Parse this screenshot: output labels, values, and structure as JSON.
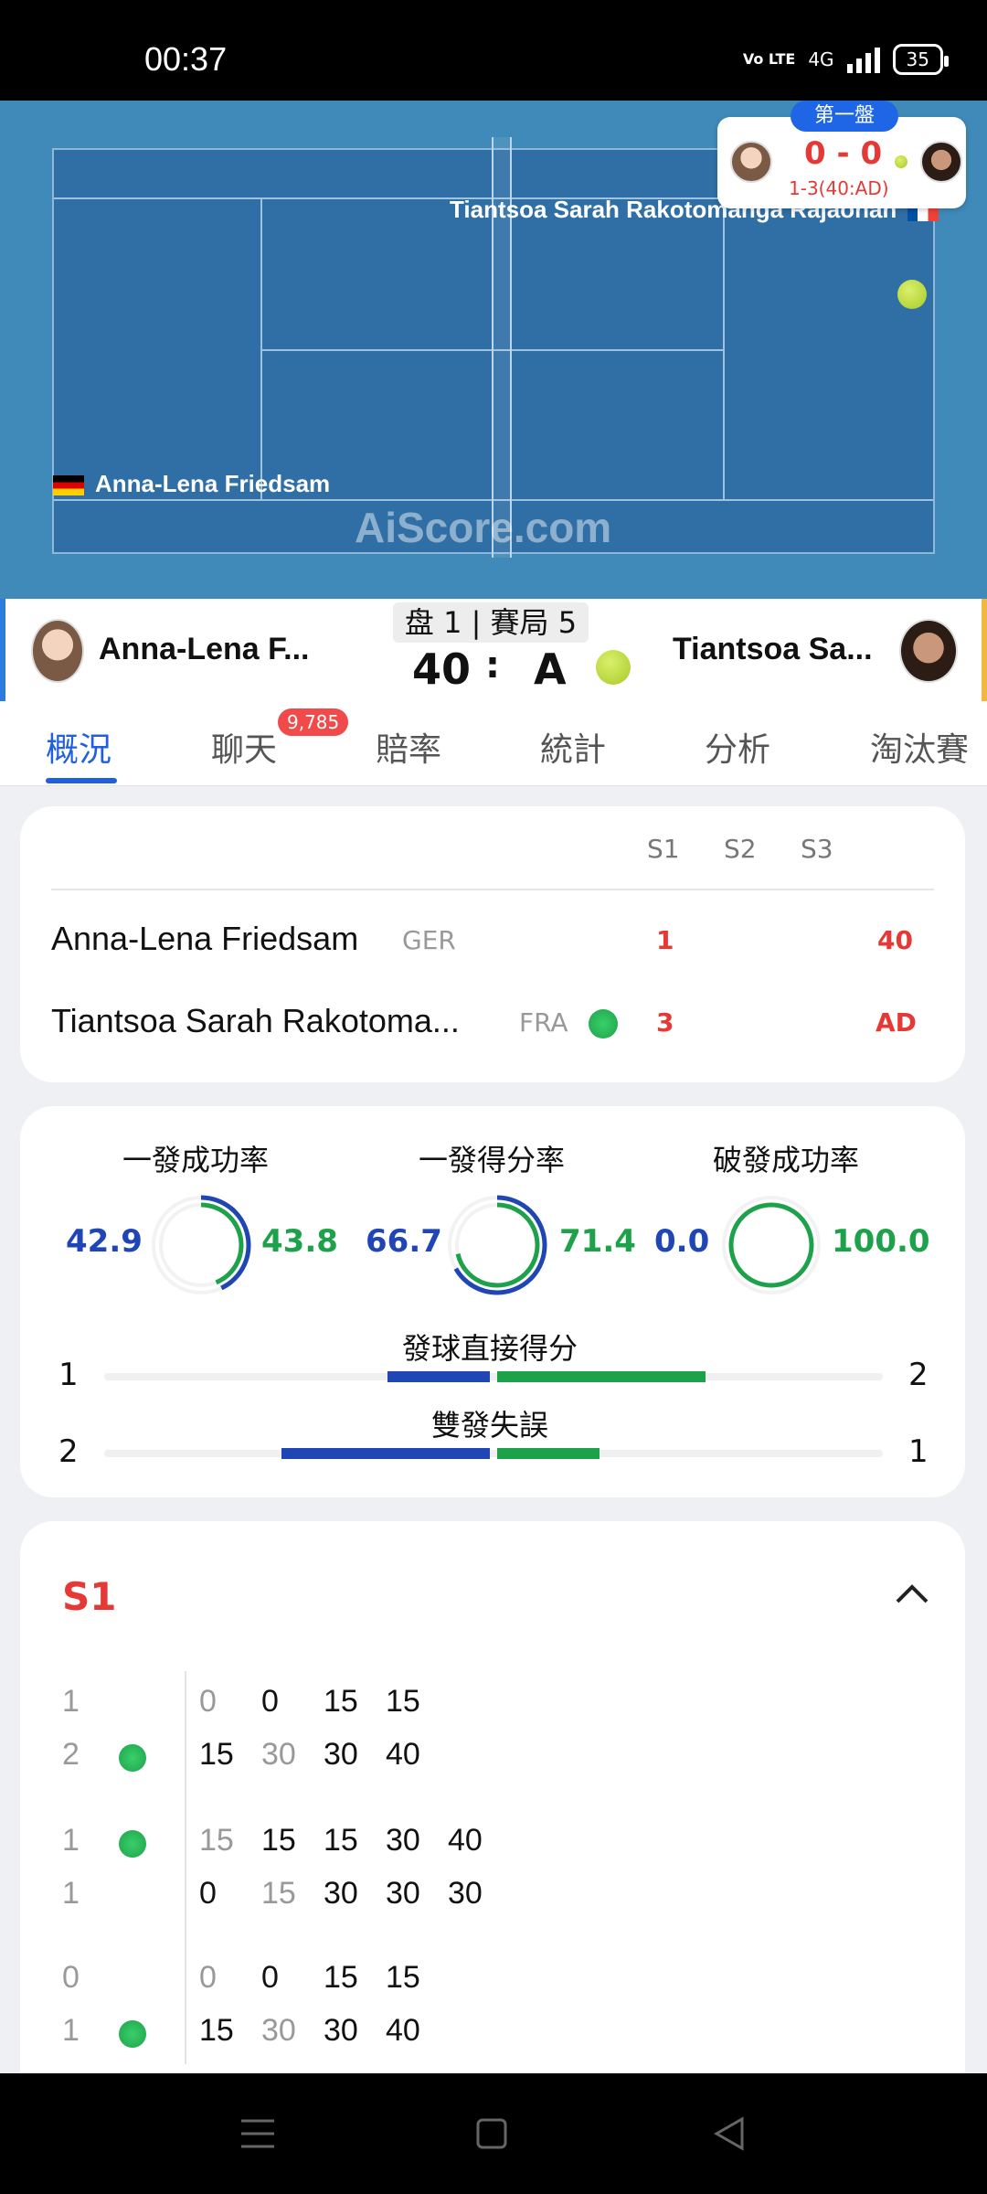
{
  "status_bar": {
    "time": "00:37",
    "network": "4G",
    "lte": "Vo LTE",
    "battery": "35"
  },
  "court": {
    "watermark": "AiScore.com",
    "player_top_label": "Tiantsoa Sarah Rakotomanga Rajaonah",
    "player_bottom_label": "Anna-Lena Friedsam"
  },
  "mini_score": {
    "set_tag": "第一盤",
    "score": "0 - 0",
    "sub": "1-3(40:AD)"
  },
  "match_header": {
    "player1_short": "Anna-Lena F...",
    "player2_short": "Tiantsoa Sa...",
    "set_game": "盘 1 | 賽局 5",
    "p1_points": "40",
    "separator": ":",
    "p2_points": "A"
  },
  "tabs": [
    {
      "label": "概況"
    },
    {
      "label": "聊天",
      "badge": "9,785"
    },
    {
      "label": "賠率"
    },
    {
      "label": "統計"
    },
    {
      "label": "分析"
    },
    {
      "label": "淘汰賽"
    }
  ],
  "scoreboard": {
    "headers": [
      "S1",
      "S2",
      "S3"
    ],
    "rows": [
      {
        "name": "Anna-Lena Friedsam",
        "nat": "GER",
        "s1": "1",
        "current": "40"
      },
      {
        "name": "Tiantsoa Sarah Rakotoma...",
        "nat": "FRA",
        "s1": "3",
        "current": "AD"
      }
    ]
  },
  "stats": {
    "circles": [
      {
        "title": "一發成功率",
        "left": "42.9",
        "right": "43.8",
        "left_frac": 0.429,
        "right_frac": 0.438
      },
      {
        "title": "一發得分率",
        "left": "66.7",
        "right": "71.4",
        "left_frac": 0.667,
        "right_frac": 0.714
      },
      {
        "title": "破發成功率",
        "left": "0.0",
        "right": "100.0",
        "left_frac": 0.0,
        "right_frac": 1.0
      }
    ],
    "bars": [
      {
        "title": "發球直接得分",
        "left": "1",
        "right": "2",
        "left_frac": 0.33,
        "right_frac": 0.67
      },
      {
        "title": "雙發失誤",
        "left": "2",
        "right": "1",
        "left_frac": 0.67,
        "right_frac": 0.33
      }
    ]
  },
  "set_detail": {
    "title": "S1",
    "games": [
      {
        "top_game": "1",
        "bottom_game": "2",
        "top_pts": [
          "0",
          "0",
          "15",
          "15"
        ],
        "bottom_pts": [
          "15",
          "30",
          "30",
          "40"
        ]
      },
      {
        "top_game": "1",
        "bottom_game": "1",
        "top_pts": [
          "15",
          "15",
          "15",
          "30",
          "40"
        ],
        "bottom_pts": [
          "0",
          "15",
          "30",
          "30",
          "30"
        ]
      },
      {
        "top_game": "0",
        "bottom_game": "1",
        "top_pts": [
          "0",
          "0",
          "15",
          "15"
        ],
        "bottom_pts": [
          "15",
          "30",
          "30",
          "40"
        ]
      }
    ]
  },
  "colors": {
    "accent": "#1f5fe0",
    "red": "#e53935",
    "blue": "#1f46b4",
    "green": "#1ea14b",
    "court": "#2f6fa5"
  }
}
